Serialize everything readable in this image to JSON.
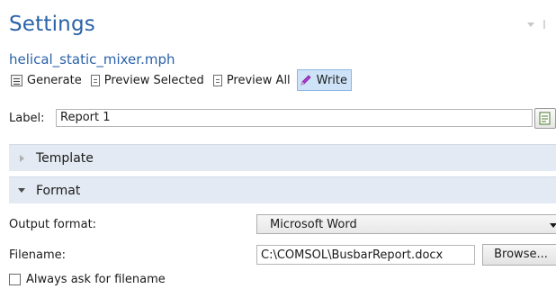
{
  "panel": {
    "title": "Settings",
    "subtitle": "helical_static_mixer.mph"
  },
  "toolbar": {
    "generate_label": "Generate",
    "preview_selected_label": "Preview Selected",
    "preview_all_label": "Preview All",
    "write_label": "Write",
    "active_button": "Write"
  },
  "label_field": {
    "label": "Label:",
    "value": "Report 1"
  },
  "sections": {
    "template": {
      "label": "Template",
      "expanded": false
    },
    "format": {
      "label": "Format",
      "expanded": true
    }
  },
  "format": {
    "output_format_label": "Output format:",
    "output_format_value": "Microsoft Word",
    "filename_label": "Filename:",
    "filename_value": "C:\\COMSOL\\BusbarReport.docx",
    "browse_label": "Browse...",
    "always_ask_label": "Always ask for filename",
    "always_ask_checked": false
  },
  "colors": {
    "title": "#2a62a8",
    "section_bg": "#e3eaf3",
    "active_button_bg": "#cfe3f8",
    "write_icon": "#b13bd6"
  },
  "icons": {
    "generate": "generate-icon",
    "preview_selected": "document-icon",
    "preview_all": "document-icon",
    "write": "pen-icon",
    "label_button": "document-icon",
    "template_arrow": "chevron-right-icon",
    "format_arrow": "chevron-down-icon"
  }
}
